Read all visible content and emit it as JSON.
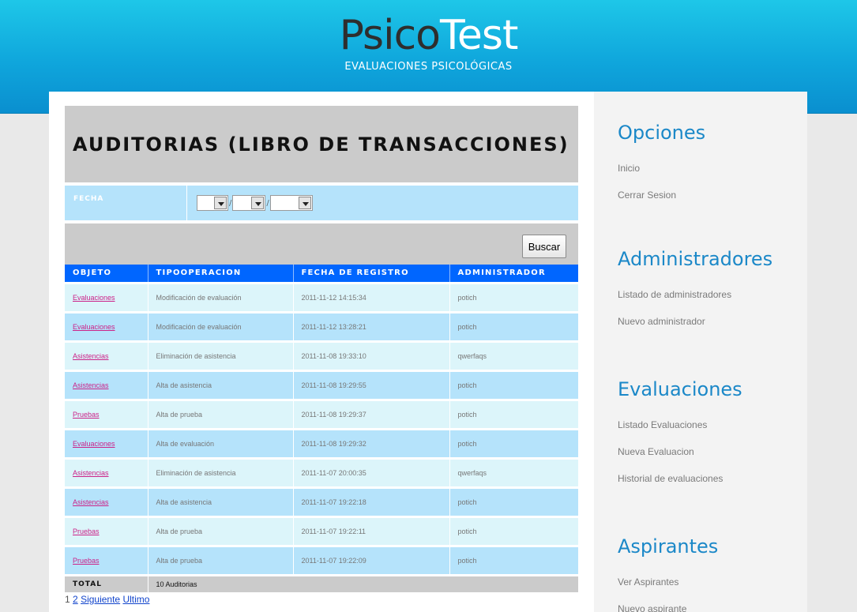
{
  "header": {
    "logo_part1": "Psico",
    "logo_part2": "Test",
    "tagline": "EVALUACIONES PSICOLÓGICAS"
  },
  "main": {
    "title": "AUDITORIAS (LIBRO DE TRANSACCIONES)",
    "filter_label": "FECHA",
    "date_separator": "/",
    "search_button": "Buscar",
    "columns": [
      "OBJETO",
      "TIPOOPERACION",
      "FECHA DE REGISTRO",
      "ADMINISTRADOR"
    ],
    "rows": [
      [
        "Evaluaciones",
        "Modificación de evaluación",
        "2011-11-12 14:15:34",
        "potich"
      ],
      [
        "Evaluaciones",
        "Modificación de evaluación",
        "2011-11-12 13:28:21",
        "potich"
      ],
      [
        "Asistencias",
        "Eliminación de asistencia",
        "2011-11-08 19:33:10",
        "qwerfaqs"
      ],
      [
        "Asistencias",
        "Alta de asistencia",
        "2011-11-08 19:29:55",
        "potich"
      ],
      [
        "Pruebas",
        "Alta de prueba",
        "2011-11-08 19:29:37",
        "potich"
      ],
      [
        "Evaluaciones",
        "Alta de evaluación",
        "2011-11-08 19:29:32",
        "potich"
      ],
      [
        "Asistencias",
        "Eliminación de asistencia",
        "2011-11-07 20:00:35",
        "qwerfaqs"
      ],
      [
        "Asistencias",
        "Alta de asistencia",
        "2011-11-07 19:22:18",
        "potich"
      ],
      [
        "Pruebas",
        "Alta de prueba",
        "2011-11-07 19:22:11",
        "potich"
      ],
      [
        "Pruebas",
        "Alta de prueba",
        "2011-11-07 19:22:09",
        "potich"
      ]
    ],
    "total_label": "TOTAL",
    "total_value": "10 Auditorias",
    "pager": {
      "current": "1",
      "page2": "2",
      "next": "Siguiente",
      "last": "Ultimo"
    }
  },
  "sidebar": {
    "sections": [
      {
        "title": "Opciones",
        "items": [
          "Inicio",
          "Cerrar Sesion"
        ]
      },
      {
        "title": "Administradores",
        "items": [
          "Listado de administradores",
          "Nuevo administrador"
        ]
      },
      {
        "title": "Evaluaciones",
        "items": [
          "Listado Evaluaciones",
          "Nueva Evaluacion",
          "Historial de evaluaciones"
        ]
      },
      {
        "title": "Aspirantes",
        "items": [
          "Ver Aspirantes",
          "Nuevo aspirante"
        ]
      }
    ]
  },
  "colors": {
    "header_blue": "#0fa6dc",
    "table_header": "#0066ff",
    "row_light": "#dcf5fa",
    "row_dark": "#b5e3fb",
    "link_pink": "#cc2288",
    "sidebar_title": "#1b88c8"
  }
}
